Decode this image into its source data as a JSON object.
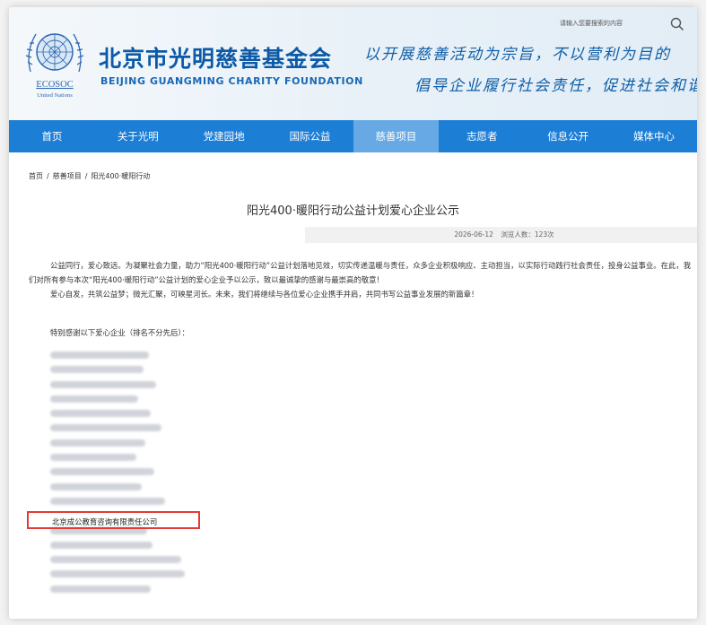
{
  "header": {
    "org_name_cn": "北京市光明慈善基金会",
    "org_name_en": "BEIJING GUANGMING CHARITY FOUNDATION",
    "emblem_label_1": "ECOSOC",
    "emblem_label_2": "United Nations",
    "slogan_line1": "以开展慈善活动为宗旨，不以营利为目的",
    "slogan_line2": "倡导企业履行社会责任，促进社会和谐进步",
    "search_placeholder": "请输入您要搜索的内容",
    "brand_color": "#0c5aa7"
  },
  "nav": {
    "items": [
      "首页",
      "关于光明",
      "党建园地",
      "国际公益",
      "慈善项目",
      "志愿者",
      "信息公开",
      "媒体中心"
    ],
    "active": "慈善项目",
    "bg_color": "#1d7ed6",
    "active_color": "#66a9e4"
  },
  "breadcrumb": {
    "home": "首页",
    "section": "慈善项目",
    "current": "阳光400·暖阳行动",
    "separator": "/"
  },
  "article": {
    "title": "阳光400·暖阳行动公益计划爱心企业公示",
    "date": "2026-06-12",
    "views_label": "浏览人数：123次",
    "paragraph1": "公益同行，爱心致远。为凝聚社会力量，助力“阳光400·暖阳行动”公益计划落地见效，切实传递温暖与责任，众多企业积极响应、主动担当，以实际行动践行社会责任，投身公益事业。在此，我们对所有参与本次“阳光400·暖阳行动”公益计划的爱心企业予以公示，致以最诚挚的感谢与最崇高的敬意！",
    "paragraph2": "爱心自发，共筑公益梦；微光汇聚，可映星河长。未来，我们将继续与各位爱心企业携手并肩，共同书写公益事业发展的新篇章！",
    "thanks_heading": "特别感谢以下爱心企业（排名不分先后）："
  },
  "companies": {
    "highlighted_name": "北京成公教育咨询有限责任公司",
    "highlight_color": "#e53935"
  },
  "icons": {
    "search": "search-icon",
    "emblem": "un-emblem-icon"
  }
}
